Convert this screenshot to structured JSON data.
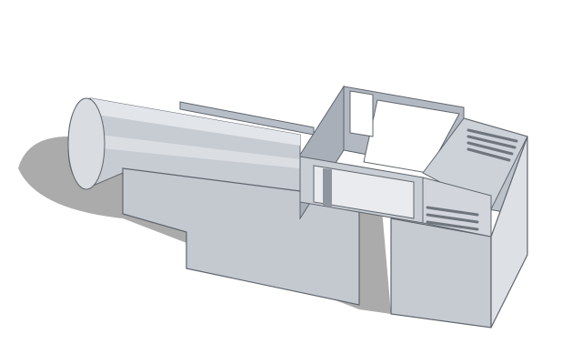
{
  "scene": {
    "background": "#ffffff",
    "object": "3d-model-enclosure",
    "colors": {
      "face_light": "#d4d8de",
      "face_mid": "#c2c7cf",
      "face_dark": "#a9afb8",
      "face_inner": "#b6bcc5",
      "edge": "#5f656d",
      "shadow": "#9c9c9c",
      "slot": "#6f757d"
    }
  }
}
